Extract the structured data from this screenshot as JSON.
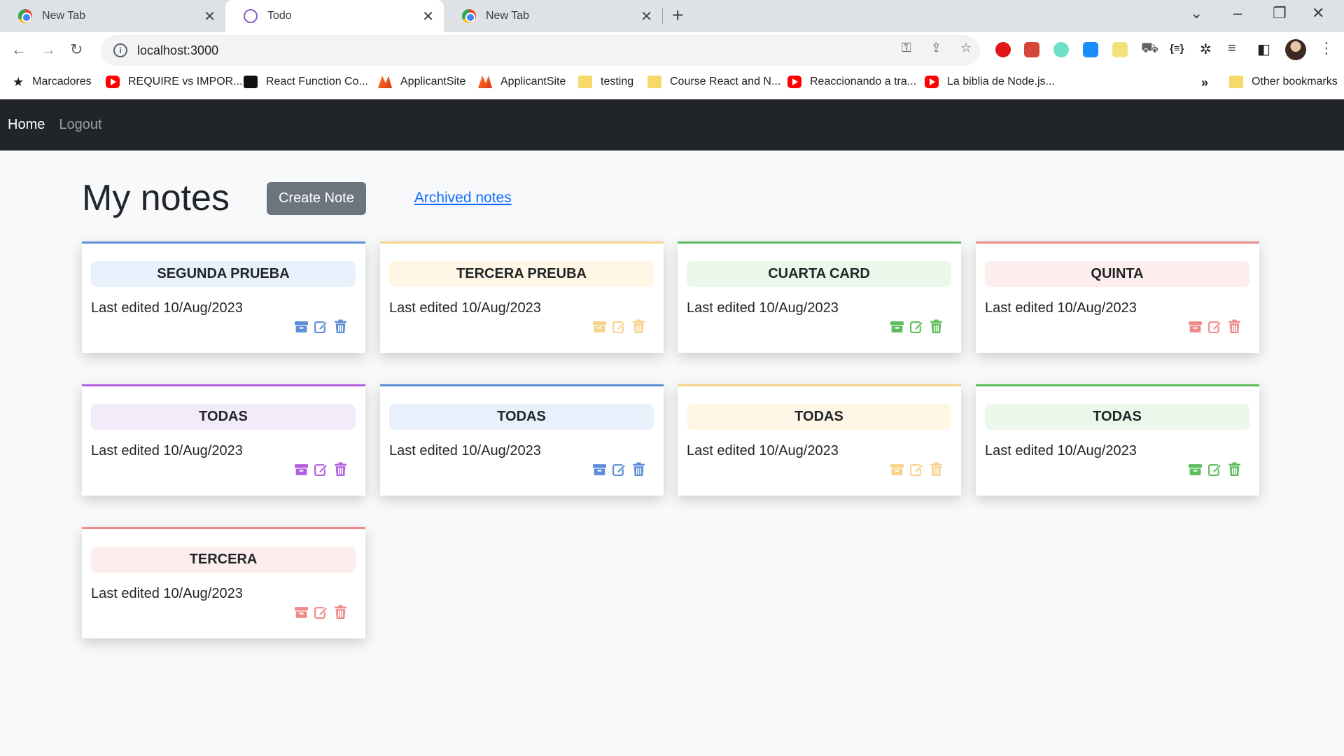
{
  "browser": {
    "tabs": [
      {
        "title": "New Tab",
        "close": "✕"
      },
      {
        "title": "Todo",
        "close": "✕"
      },
      {
        "title": "New Tab",
        "close": "✕"
      }
    ],
    "new_tab": "+",
    "address": "localhost:3000",
    "bookmarks": [
      {
        "label": "Marcadores",
        "icon": "star"
      },
      {
        "label": "REQUIRE vs IMPOR...",
        "icon": "youtube"
      },
      {
        "label": "React Function Co...",
        "icon": "video"
      },
      {
        "label": "ApplicantSite",
        "icon": "applicant"
      },
      {
        "label": "ApplicantSite",
        "icon": "applicant"
      },
      {
        "label": "testing",
        "icon": "folder"
      },
      {
        "label": "Course React and N...",
        "icon": "folder"
      },
      {
        "label": "Reaccionando a tra...",
        "icon": "youtube"
      },
      {
        "label": "La biblia de Node.js...",
        "icon": "youtube"
      }
    ],
    "more_bookmarks": "»",
    "other_bookmarks": "Other bookmarks"
  },
  "nav": {
    "home": "Home",
    "logout": "Logout"
  },
  "page": {
    "title": "My notes",
    "create_button": "Create Note",
    "archived_link": "Archived notes"
  },
  "colors": {
    "blue": {
      "border": "#5b8ed6",
      "bg": "#e8f0fc",
      "icon": "#5b8ed6"
    },
    "yellow": {
      "border": "#f7d28a",
      "bg": "#fff6e6",
      "icon": "#f7d28a"
    },
    "green": {
      "border": "#5cbd5c",
      "bg": "#ebf7eb",
      "icon": "#5cbd5c"
    },
    "red": {
      "border": "#ef8a8a",
      "bg": "#fdeded",
      "icon": "#ef8a8a"
    },
    "purple": {
      "border": "#b25fe0",
      "bg": "#f1ebfa",
      "icon": "#b25fe0"
    }
  },
  "notes": [
    {
      "title": "SEGUNDA PRUEBA",
      "date": "Last edited 10/Aug/2023",
      "color": "blue"
    },
    {
      "title": "TERCERA PREUBA",
      "date": "Last edited 10/Aug/2023",
      "color": "yellow"
    },
    {
      "title": "CUARTA CARD",
      "date": "Last edited 10/Aug/2023",
      "color": "green"
    },
    {
      "title": "QUINTA",
      "date": "Last edited 10/Aug/2023",
      "color": "red"
    },
    {
      "title": "TODAS",
      "date": "Last edited 10/Aug/2023",
      "color": "purple"
    },
    {
      "title": "TODAS",
      "date": "Last edited 10/Aug/2023",
      "color": "blue"
    },
    {
      "title": "TODAS",
      "date": "Last edited 10/Aug/2023",
      "color": "yellow"
    },
    {
      "title": "TODAS",
      "date": "Last edited 10/Aug/2023",
      "color": "green"
    },
    {
      "title": "TERCERA",
      "date": "Last edited 10/Aug/2023",
      "color": "red"
    }
  ]
}
